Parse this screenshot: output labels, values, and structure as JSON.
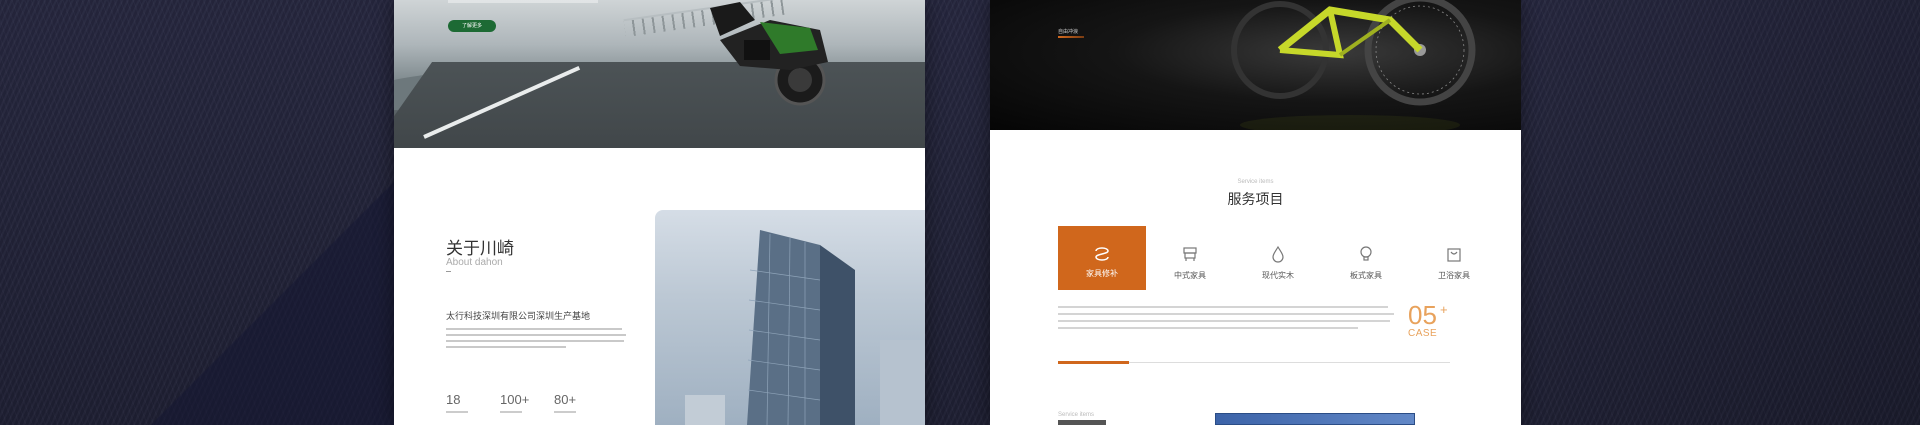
{
  "left_mockup": {
    "hero": {
      "button_label": "了解更多"
    },
    "about": {
      "title": "关于川崎",
      "subtitle": "About dahon",
      "company": "太行科技深圳有限公司深圳生产基地"
    },
    "stats": [
      {
        "value": "18"
      },
      {
        "value": "100+"
      },
      {
        "value": "80+"
      }
    ]
  },
  "right_mockup": {
    "hero": {
      "label": "自由冲浪"
    },
    "services": {
      "subtitle_en": "Service items",
      "title": "服务项目",
      "tabs": [
        {
          "label": "家具修补",
          "icon": "swirl-icon",
          "active": true
        },
        {
          "label": "中式家具",
          "icon": "chair-icon",
          "active": false
        },
        {
          "label": "现代实木",
          "icon": "drop-icon",
          "active": false
        },
        {
          "label": "板式家具",
          "icon": "bulb-icon",
          "active": false
        },
        {
          "label": "卫浴家具",
          "icon": "bag-icon",
          "active": false
        }
      ],
      "case_number": "05",
      "case_plus": "+",
      "case_label": "CASE",
      "progress_fraction": 0.18
    },
    "section2": {
      "subtitle_en": "Service items"
    }
  },
  "colors": {
    "accent_orange": "#d0671c",
    "case_orange": "#e8a25c",
    "button_green": "#1d6a34",
    "background": "#23233a"
  }
}
